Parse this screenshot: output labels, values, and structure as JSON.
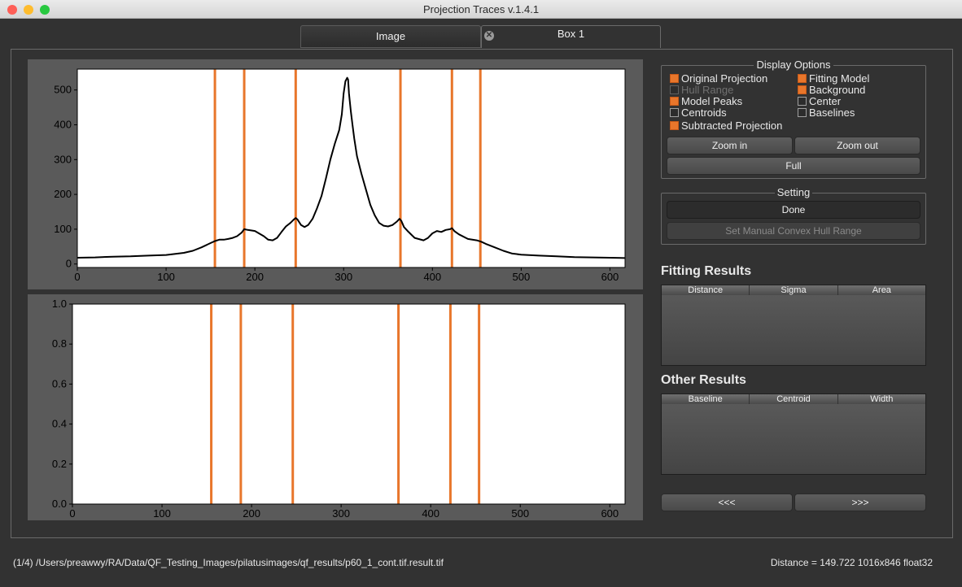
{
  "window": {
    "title": "Projection Traces v.1.4.1",
    "traffic_lights": {
      "close": "#fe5f57",
      "minimize": "#febc2e",
      "zoom": "#28c840"
    }
  },
  "tabs": [
    {
      "label": "Image",
      "active": false
    },
    {
      "label": "Box 1",
      "active": true,
      "closable": true
    }
  ],
  "tab_close_icon": "✕",
  "display_options": {
    "title": "Display Options",
    "checkboxes": [
      {
        "label": "Original Projection",
        "checked": true,
        "enabled": true
      },
      {
        "label": "Hull Range",
        "checked": false,
        "enabled": false
      },
      {
        "label": "Model Peaks",
        "checked": true,
        "enabled": true
      },
      {
        "label": "Centroids",
        "checked": false,
        "enabled": true
      },
      {
        "label": "Subtracted Projection",
        "checked": true,
        "enabled": true
      },
      {
        "label": "Fitting Model",
        "checked": true,
        "enabled": true
      },
      {
        "label": "Background",
        "checked": true,
        "enabled": true
      },
      {
        "label": "Center",
        "checked": false,
        "enabled": true
      },
      {
        "label": "Baselines",
        "checked": false,
        "enabled": true
      }
    ],
    "buttons": {
      "zoom_in": "Zoom in",
      "zoom_out": "Zoom out",
      "full": "Full"
    }
  },
  "setting": {
    "title": "Setting",
    "done": "Done",
    "manual_hull": "Set Manual Convex Hull Range"
  },
  "fitting_results": {
    "title": "Fitting Results",
    "columns": [
      "Distance",
      "Sigma",
      "Area"
    ]
  },
  "other_results": {
    "title": "Other Results",
    "columns": [
      "Baseline",
      "Centroid",
      "Width"
    ]
  },
  "nav": {
    "prev": "<<<",
    "next": ">>>"
  },
  "status": {
    "path": "(1/4) /Users/preawwy/RA/Data/QF_Testing_Images/pilatusimages/qf_results/p60_1_cont.tif.result.tif",
    "info": "Distance = 149.722  1016x846 float32"
  },
  "colors": {
    "accent": "#e8762b",
    "background": "#323232",
    "plot_frame": "#5a5a5a"
  },
  "chart_data": [
    {
      "type": "line",
      "title": "",
      "xlabel": "",
      "ylabel": "",
      "xlim": [
        0,
        617
      ],
      "ylim": [
        -10,
        560
      ],
      "xticks": [
        0,
        100,
        200,
        300,
        400,
        500,
        600
      ],
      "yticks": [
        0,
        100,
        200,
        300,
        400,
        500
      ],
      "series": [
        {
          "color": "#000000",
          "x": [
            0,
            20,
            40,
            60,
            80,
            100,
            120,
            130,
            140,
            150,
            155,
            160,
            165,
            170,
            175,
            180,
            185,
            188,
            192,
            200,
            210,
            215,
            220,
            225,
            230,
            235,
            240,
            244,
            246,
            248,
            252,
            256,
            260,
            265,
            270,
            275,
            280,
            285,
            290,
            295,
            298,
            300,
            302,
            304,
            305,
            306,
            308,
            310,
            312,
            315,
            320,
            325,
            330,
            335,
            340,
            345,
            350,
            355,
            360,
            363,
            365,
            368,
            372,
            380,
            390,
            395,
            400,
            405,
            410,
            415,
            420,
            422,
            425,
            430,
            440,
            450,
            455,
            460,
            470,
            480,
            490,
            500,
            520,
            540,
            560,
            580,
            600,
            617
          ],
          "y": [
            18,
            19,
            21,
            22,
            24,
            26,
            32,
            38,
            48,
            60,
            66,
            70,
            70,
            72,
            75,
            80,
            90,
            100,
            98,
            95,
            80,
            70,
            68,
            75,
            92,
            108,
            118,
            128,
            132,
            128,
            112,
            106,
            112,
            130,
            160,
            195,
            245,
            300,
            345,
            385,
            430,
            490,
            525,
            535,
            530,
            490,
            440,
            400,
            360,
            310,
            260,
            215,
            170,
            140,
            118,
            110,
            108,
            112,
            122,
            130,
            124,
            106,
            95,
            75,
            68,
            75,
            88,
            95,
            92,
            98,
            100,
            103,
            94,
            85,
            72,
            68,
            64,
            58,
            48,
            38,
            30,
            27,
            24,
            22,
            20,
            19,
            18,
            17
          ]
        }
      ],
      "vertical_lines": {
        "color": "#e8762b",
        "x": [
          155,
          188,
          246,
          364,
          422,
          454
        ]
      }
    },
    {
      "type": "line",
      "title": "",
      "xlabel": "",
      "ylabel": "",
      "xlim": [
        0,
        617
      ],
      "ylim": [
        0,
        1
      ],
      "xticks": [
        0,
        100,
        200,
        300,
        400,
        500,
        600
      ],
      "yticks": [
        "0.0",
        "0.2",
        "0.4",
        "0.6",
        "0.8",
        "1.0"
      ],
      "series": [],
      "vertical_lines": {
        "color": "#e8762b",
        "x": [
          155,
          188,
          246,
          364,
          422,
          454
        ]
      }
    }
  ]
}
